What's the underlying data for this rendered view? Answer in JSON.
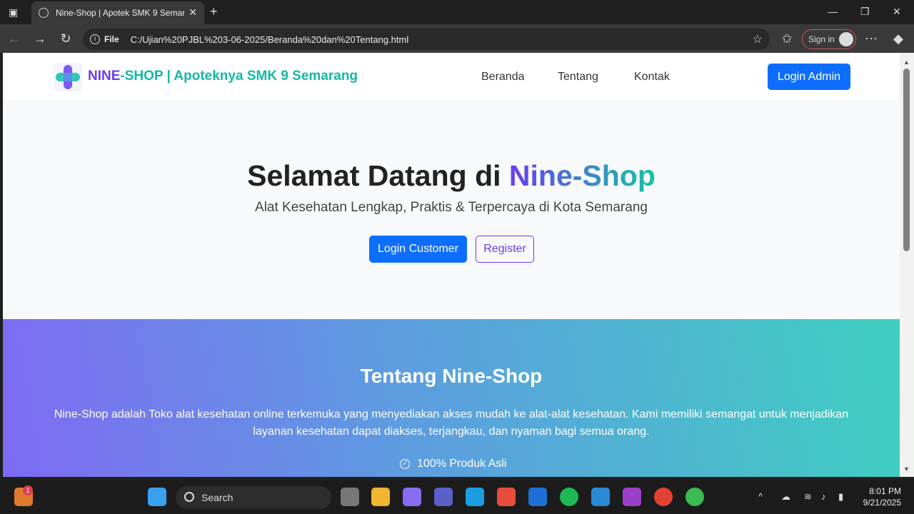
{
  "browser": {
    "tab_title": "Nine-Shop | Apotek SMK 9 Semarang",
    "address_label": "File",
    "url": "C:/Ujian%20PJBL%203-06-2025/Beranda%20dan%20Tentang.html",
    "signin_label": "Sign in"
  },
  "site": {
    "brand_part1": "NINE",
    "brand_part2": "-SHOP | Apoteknya SMK 9 Semarang",
    "menu": [
      "Beranda",
      "Tentang",
      "Kontak"
    ],
    "admin_button": "Login Admin"
  },
  "hero": {
    "title_prefix": "Selamat Datang di ",
    "title_highlight": "Nine-Shop",
    "subtitle": "Alat Kesehatan Lengkap, Praktis & Terpercaya di Kota Semarang",
    "customer_button": "Login Customer",
    "register_button": "Register"
  },
  "about": {
    "heading": "Tentang Nine-Shop",
    "description": "Nine-Shop adalah Toko alat kesehatan online terkemuka yang menyediakan akses mudah ke alat-alat kesehatan. Kami memiliki semangat untuk menjadikan layanan kesehatan dapat diakses, terjangkau, dan nyaman bagi semua orang.",
    "feature_1": "100% Produk Asli"
  },
  "taskbar": {
    "search_placeholder": "Search",
    "notification_count": "1",
    "time": "8:01 PM",
    "date": "9/21/2025"
  },
  "colors": {
    "primary": "#0d6efd",
    "brand_purple": "#6a3df0",
    "brand_teal": "#13b8a6"
  }
}
